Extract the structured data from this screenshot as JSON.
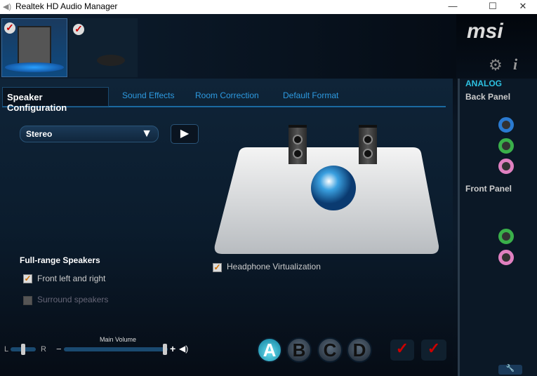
{
  "window": {
    "title": "Realtek HD Audio Manager",
    "minimize": "—",
    "maximize": "☐",
    "close": "✕"
  },
  "brand": {
    "logo": "msi"
  },
  "devices": [
    {
      "name": "speakers",
      "icon": "speaker-pair-icon",
      "active": true
    },
    {
      "name": "microphone",
      "icon": "microphone-icon",
      "active": false
    }
  ],
  "tabs": [
    {
      "label": "Speaker Configuration",
      "active": true
    },
    {
      "label": "Sound Effects"
    },
    {
      "label": "Room Correction"
    },
    {
      "label": "Default Format"
    }
  ],
  "config": {
    "selected": "Stereo",
    "play_icon": "▶"
  },
  "full_range": {
    "title": "Full-range Speakers",
    "items": [
      {
        "label": "Front left and right",
        "checked": true,
        "enabled": true
      },
      {
        "label": "Surround speakers",
        "checked": false,
        "enabled": false
      }
    ]
  },
  "headphone_virtualization": {
    "label": "Headphone Virtualization",
    "checked": true
  },
  "volume": {
    "title": "Main Volume",
    "balance_left": "L",
    "balance_right": "R",
    "minus": "−",
    "plus": "+",
    "level": 0.97,
    "balance": 0.5
  },
  "profiles": [
    "A",
    "B",
    "C",
    "D"
  ],
  "active_profile": "A",
  "right_panel": {
    "analog": "ANALOG",
    "back_panel": "Back Panel",
    "front_panel": "Front Panel",
    "back_jacks": [
      "#2a7ad0",
      "#3ab04a",
      "#e080c0"
    ],
    "front_jacks": [
      "#3ab04a",
      "#e080c0"
    ]
  },
  "colors": {
    "accent": "#2d9ae0",
    "analog": "#2dc0e0"
  }
}
